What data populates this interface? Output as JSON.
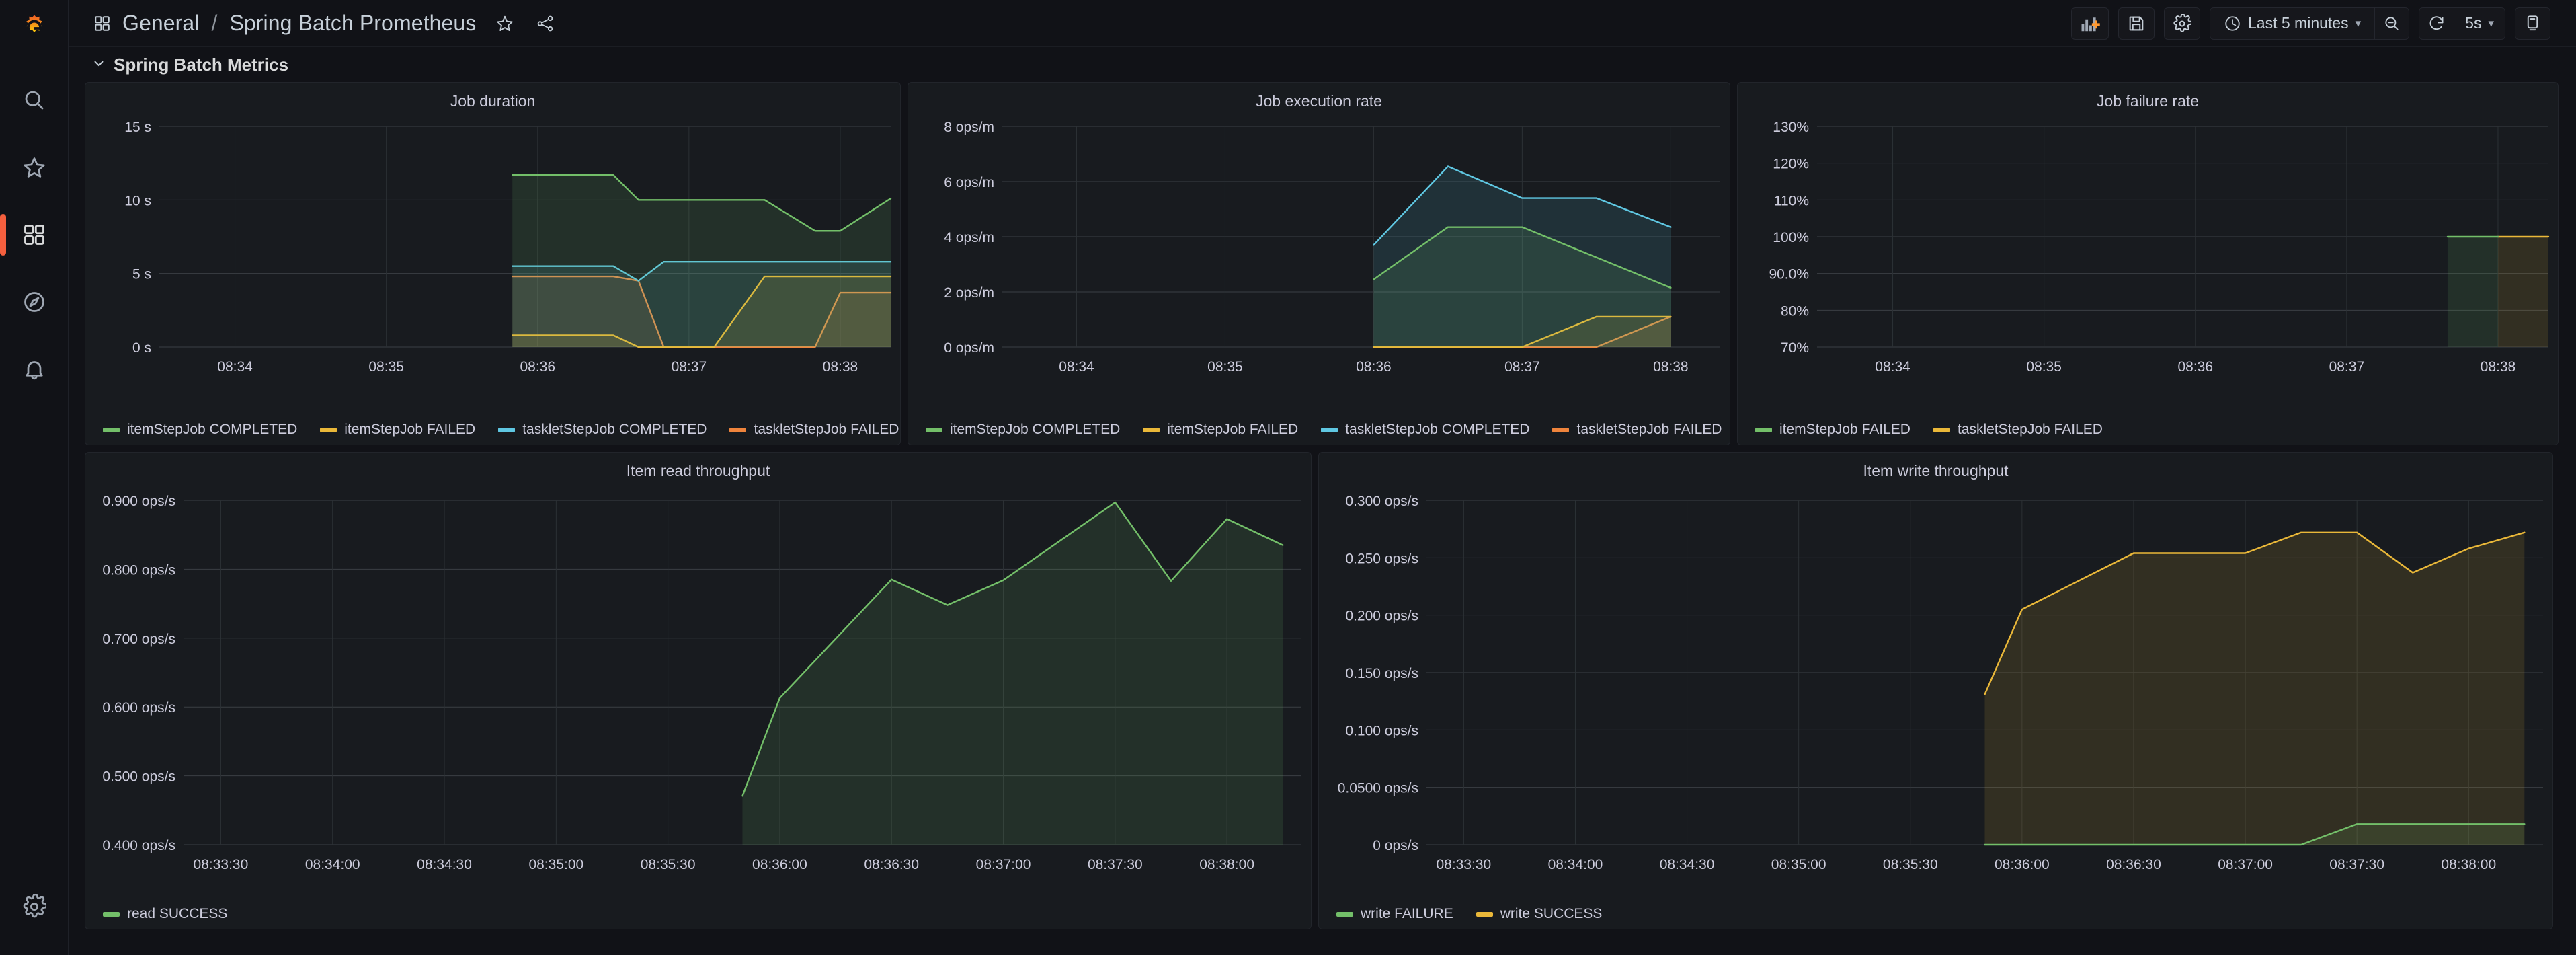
{
  "app": {
    "logo": "grafana-logo",
    "sidebar_items": [
      {
        "name": "search-icon",
        "label": "Search"
      },
      {
        "name": "starred-icon",
        "label": "Starred"
      },
      {
        "name": "dashboards-icon",
        "label": "Dashboards",
        "active": true
      },
      {
        "name": "explore-icon",
        "label": "Explore"
      },
      {
        "name": "alerting-icon",
        "label": "Alerting"
      }
    ],
    "sidebar_bottom": {
      "name": "configuration-icon",
      "label": "Configuration"
    }
  },
  "header": {
    "folder": "General",
    "separator": "/",
    "dashboard": "Spring Batch Prometheus",
    "star_label": "Mark as favorite",
    "share_label": "Share dashboard",
    "toolbar": {
      "add_panel_label": "Add panel",
      "save_label": "Save dashboard",
      "settings_label": "Dashboard settings",
      "time_range": "Last 5 minutes",
      "zoom_out_label": "Zoom out time range",
      "refresh_label": "Refresh dashboard",
      "refresh_interval": "5s",
      "tv_label": "Cycle view mode"
    }
  },
  "row": {
    "title": "Spring Batch Metrics",
    "collapsed": false
  },
  "colors": {
    "green": "#73bf69",
    "yellow": "#eab839",
    "blue": "#5fc7e2",
    "orange": "#ef843c",
    "accent": "#f55f3e",
    "panel_bg": "#181b1f",
    "page_bg": "#111217",
    "grid": "#2c3235",
    "text": "#ccccdc"
  },
  "chart_data": [
    {
      "id": "job-duration",
      "type": "area",
      "title": "Job duration",
      "xlabel": "",
      "ylabel": "",
      "ylim": [
        0,
        15
      ],
      "yticks": [
        0,
        5,
        10,
        15
      ],
      "ytick_labels": [
        "0 s",
        "5 s",
        "10 s",
        "15 s"
      ],
      "xticks": [
        "08:34",
        "08:35",
        "08:36",
        "08:37",
        "08:38"
      ],
      "xlim": [
        "08:33:30",
        "08:38:20"
      ],
      "grid": true,
      "legend_position": "bottom",
      "x": [
        "08:35:50",
        "08:36:00",
        "08:36:30",
        "08:36:40",
        "08:36:50",
        "08:37:00",
        "08:37:10",
        "08:37:30",
        "08:37:50",
        "08:38:00",
        "08:38:20"
      ],
      "series": [
        {
          "name": "itemStepJob COMPLETED",
          "color": "#73bf69",
          "values": [
            11.7,
            11.7,
            11.7,
            10.0,
            10.0,
            10.0,
            10.0,
            10.0,
            7.9,
            7.9,
            10.1
          ]
        },
        {
          "name": "itemStepJob FAILED",
          "color": "#eab839",
          "values": [
            0.8,
            0.8,
            0.8,
            0.0,
            0.0,
            0.0,
            0.0,
            4.8,
            4.8,
            4.8,
            4.8
          ]
        },
        {
          "name": "taskletStepJob COMPLETED",
          "color": "#5fc7e2",
          "values": [
            5.5,
            5.5,
            5.5,
            4.5,
            5.8,
            5.8,
            5.8,
            5.8,
            5.8,
            5.8,
            5.8
          ]
        },
        {
          "name": "taskletStepJob FAILED",
          "color": "#ef843c",
          "values": [
            4.8,
            4.8,
            4.8,
            4.5,
            0.0,
            0.0,
            0.0,
            0.0,
            0.0,
            3.7,
            3.7
          ]
        }
      ]
    },
    {
      "id": "job-execution-rate",
      "type": "area",
      "title": "Job execution rate",
      "xlabel": "",
      "ylabel": "",
      "ylim": [
        0,
        8
      ],
      "yticks": [
        0,
        2,
        4,
        6,
        8
      ],
      "ytick_labels": [
        "0 ops/m",
        "2 ops/m",
        "4 ops/m",
        "6 ops/m",
        "8 ops/m"
      ],
      "xticks": [
        "08:34",
        "08:35",
        "08:36",
        "08:37",
        "08:38"
      ],
      "xlim": [
        "08:33:30",
        "08:38:20"
      ],
      "grid": true,
      "legend_position": "bottom",
      "x": [
        "08:36:00",
        "08:36:30",
        "08:37:00",
        "08:37:30",
        "08:38:00"
      ],
      "series": [
        {
          "name": "itemStepJob COMPLETED",
          "color": "#73bf69",
          "values": [
            2.45,
            4.35,
            4.35,
            3.25,
            2.15
          ]
        },
        {
          "name": "itemStepJob FAILED",
          "color": "#eab839",
          "values": [
            0.0,
            0.0,
            0.0,
            1.1,
            1.1
          ]
        },
        {
          "name": "taskletStepJob COMPLETED",
          "color": "#5fc7e2",
          "values": [
            3.7,
            6.55,
            5.4,
            5.4,
            4.35
          ]
        },
        {
          "name": "taskletStepJob FAILED",
          "color": "#ef843c",
          "values": [
            0.0,
            0.0,
            0.0,
            0.0,
            1.1
          ]
        }
      ]
    },
    {
      "id": "job-failure-rate",
      "type": "area",
      "title": "Job failure rate",
      "xlabel": "",
      "ylabel": "",
      "ylim": [
        70,
        130
      ],
      "yticks": [
        70,
        80,
        90,
        100,
        110,
        120,
        130
      ],
      "ytick_labels": [
        "70%",
        "80%",
        "90.0%",
        "100%",
        "110%",
        "120%",
        "130%"
      ],
      "xticks": [
        "08:34",
        "08:35",
        "08:36",
        "08:37",
        "08:38"
      ],
      "xlim": [
        "08:33:30",
        "08:38:20"
      ],
      "grid": true,
      "legend_position": "bottom",
      "x": [
        "08:37:40",
        "08:38:00",
        "08:38:20"
      ],
      "series": [
        {
          "name": "itemStepJob FAILED",
          "color": "#73bf69",
          "values": [
            100,
            100,
            null
          ]
        },
        {
          "name": "taskletStepJob FAILED",
          "color": "#eab839",
          "values": [
            null,
            100,
            100
          ]
        }
      ]
    },
    {
      "id": "item-read-throughput",
      "type": "area",
      "title": "Item read throughput",
      "xlabel": "",
      "ylabel": "",
      "ylim": [
        0.4,
        0.9
      ],
      "yticks": [
        0.4,
        0.5,
        0.6,
        0.7,
        0.8,
        0.9
      ],
      "ytick_labels": [
        "0.400 ops/s",
        "0.500 ops/s",
        "0.600 ops/s",
        "0.700 ops/s",
        "0.800 ops/s",
        "0.900 ops/s"
      ],
      "xticks": [
        "08:33:30",
        "08:34:00",
        "08:34:30",
        "08:35:00",
        "08:35:30",
        "08:36:00",
        "08:36:30",
        "08:37:00",
        "08:37:30",
        "08:38:00"
      ],
      "xlim": [
        "08:33:20",
        "08:38:20"
      ],
      "grid": true,
      "legend_position": "bottom",
      "x": [
        "08:35:50",
        "08:36:00",
        "08:36:30",
        "08:36:45",
        "08:37:00",
        "08:37:30",
        "08:37:45",
        "08:38:00",
        "08:38:15"
      ],
      "series": [
        {
          "name": "read SUCCESS",
          "color": "#73bf69",
          "values": [
            0.471,
            0.613,
            0.785,
            0.748,
            0.784,
            0.897,
            0.783,
            0.873,
            0.835
          ]
        }
      ]
    },
    {
      "id": "item-write-throughput",
      "type": "area",
      "title": "Item write throughput",
      "xlabel": "",
      "ylabel": "",
      "ylim": [
        0,
        0.3
      ],
      "yticks": [
        0,
        0.05,
        0.1,
        0.15,
        0.2,
        0.25,
        0.3
      ],
      "ytick_labels": [
        "0 ops/s",
        "0.0500 ops/s",
        "0.100 ops/s",
        "0.150 ops/s",
        "0.200 ops/s",
        "0.250 ops/s",
        "0.300 ops/s"
      ],
      "xticks": [
        "08:33:30",
        "08:34:00",
        "08:34:30",
        "08:35:00",
        "08:35:30",
        "08:36:00",
        "08:36:30",
        "08:37:00",
        "08:37:30",
        "08:38:00"
      ],
      "xlim": [
        "08:33:20",
        "08:38:20"
      ],
      "grid": true,
      "legend_position": "bottom",
      "x": [
        "08:35:50",
        "08:36:00",
        "08:36:30",
        "08:37:00",
        "08:37:15",
        "08:37:30",
        "08:37:45",
        "08:38:00",
        "08:38:15"
      ],
      "series": [
        {
          "name": "write FAILURE",
          "color": "#73bf69",
          "values": [
            0.0,
            0.0,
            0.0,
            0.0,
            0.0,
            0.018,
            0.018,
            0.018,
            0.018
          ]
        },
        {
          "name": "write SUCCESS",
          "color": "#eab839",
          "values": [
            0.131,
            0.205,
            0.254,
            0.254,
            0.272,
            0.272,
            0.237,
            0.258,
            0.272
          ]
        }
      ]
    }
  ]
}
